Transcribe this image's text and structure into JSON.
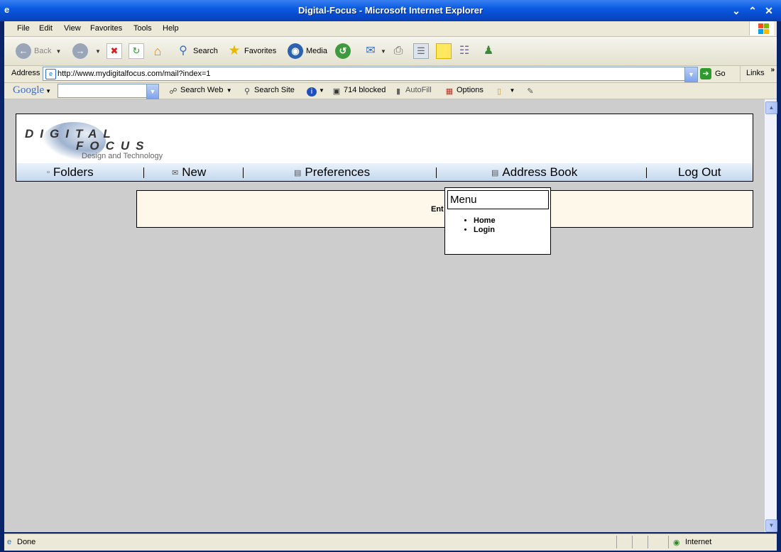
{
  "window": {
    "title": "Digital-Focus - Microsoft Internet Explorer"
  },
  "menu": {
    "items": [
      "File",
      "Edit",
      "View",
      "Favorites",
      "Tools",
      "Help"
    ]
  },
  "toolbar": {
    "back": "Back",
    "search": "Search",
    "favorites": "Favorites",
    "media": "Media"
  },
  "address": {
    "label": "Address",
    "url": "http://www.mydigitalfocus.com/mail?index=1",
    "go": "Go",
    "links": "Links"
  },
  "google": {
    "logo": "Google",
    "search_web": "Search Web",
    "search_site": "Search Site",
    "blocked": "714 blocked",
    "autofill": "AutoFill",
    "options": "Options"
  },
  "site": {
    "logo_line1": "DIGITAL",
    "logo_line2": "FOCUS",
    "logo_tagline": "Design and Technology",
    "nav": {
      "folders": "Folders",
      "new": "New",
      "preferences": "Preferences",
      "address_book": "Address Book",
      "log_out": "Log Out"
    },
    "notice_text": "Ent"
  },
  "popup_menu": {
    "title": "Menu",
    "items": [
      "Home",
      "Login"
    ]
  },
  "status": {
    "text": "Done",
    "zone": "Internet"
  }
}
